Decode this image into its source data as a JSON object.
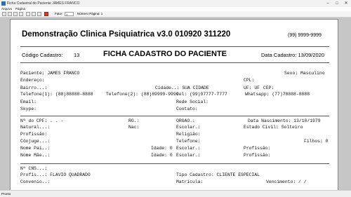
{
  "window": {
    "title": "Ficha Cadastral do Paciente JAMES FRANCO",
    "minimize": "–",
    "maximize": "□",
    "close": "✕"
  },
  "menu": {
    "items": [
      "Arquivo",
      "Página"
    ]
  },
  "toolbar": {
    "zoom_label": "Fator:",
    "zoom_value": "1",
    "page_label": "Número Página: 1"
  },
  "status": {
    "text": "Pronto"
  },
  "report": {
    "clinic_name": "Demonstração Clinica Psiquiatrica v3.0 010920 311220",
    "clinic_phone": "(99) 9999-9999",
    "code_label": "Código Cadastro:",
    "code_value": "13",
    "form_title": "FICHA CADASTRO DO PACIENTE",
    "register_date": "Data Cadastro: 13/09/2020",
    "fields": [
      {
        "text": "Paciente: JAMES FRANCO",
        "col": 0,
        "row": 0
      },
      {
        "text": "Sexo: Masculino",
        "col": 5,
        "row": 0
      },
      {
        "text": "Endereço:",
        "col": 0,
        "row": 1
      },
      {
        "text": "CPL:",
        "col": 6,
        "row": 1
      },
      {
        "text": "Bairro...:",
        "col": 0,
        "row": 2
      },
      {
        "text": "Cidade..: SUA CIDADE",
        "col": 2,
        "row": 2
      },
      {
        "text": "UF: UF",
        "col": 6,
        "row": 2
      },
      {
        "text": "CEP:",
        "col": 7,
        "row": 2
      },
      {
        "text": "Telefone(1): (88)88888-8888",
        "col": 0,
        "row": 3
      },
      {
        "text": "Telefone(2): (88)89999-9999",
        "col": 1,
        "row": 3
      },
      {
        "text": "Cel: (99)97777-7777",
        "col": 3,
        "row": 3
      },
      {
        "text": "Whatsapp: (77)78888-8888",
        "col": 4,
        "row": 3
      },
      {
        "text": "Email:",
        "col": 0,
        "row": 4
      },
      {
        "text": "Rede Social:",
        "col": 3,
        "row": 4
      },
      {
        "text": "Skype:",
        "col": 0,
        "row": 5
      },
      {
        "text": "Contato:",
        "col": 3,
        "row": 5
      },
      {
        "text": "Nº do CPF:   .   .   -",
        "col": 0,
        "row": 6
      },
      {
        "text": "RG.:",
        "col": 8,
        "row": 6
      },
      {
        "text": "ORGAO.:",
        "col": 3,
        "row": 6
      },
      {
        "text": "Data Nascimento: 13/10/1979",
        "col": 9,
        "row": 6
      },
      {
        "text": "Natural...:",
        "col": 0,
        "row": 7
      },
      {
        "text": "Nac:",
        "col": 8,
        "row": 7
      },
      {
        "text": "Escolar.:",
        "col": 3,
        "row": 7
      },
      {
        "text": "Estado Civil: Solteiro",
        "col": 10,
        "row": 7
      },
      {
        "text": "Profissão:",
        "col": 0,
        "row": 8
      },
      {
        "text": "Religião:",
        "col": 3,
        "row": 8
      },
      {
        "text": "Cônjuge...:",
        "col": 0,
        "row": 9
      },
      {
        "text": "Telefone:",
        "col": 3,
        "row": 9
      },
      {
        "text": "Filhos:  0",
        "col": 11,
        "row": 9
      },
      {
        "text": "Nome Pai..:",
        "col": 0,
        "row": 10
      },
      {
        "text": "Idade:  0",
        "col": 12,
        "row": 10
      },
      {
        "text": "Escolar.:",
        "col": 3,
        "row": 10
      },
      {
        "text": "Profissão:",
        "col": 10,
        "row": 10
      },
      {
        "text": "Nome Mãe..:",
        "col": 0,
        "row": 11
      },
      {
        "text": "Idade:  0",
        "col": 12,
        "row": 11
      },
      {
        "text": "Escolar.:",
        "col": 3,
        "row": 11
      },
      {
        "text": "Profissão:",
        "col": 10,
        "row": 11
      },
      {
        "text": "Nº CNS...:",
        "col": 0,
        "row": 12
      },
      {
        "text": "Profis...: FLAVIO QUADRADO",
        "col": 0,
        "row": 13
      },
      {
        "text": "Tipo Cadastro: CLIENTE ESPECIAL",
        "col": 3,
        "row": 13
      },
      {
        "text": "Convenio..:",
        "col": 0,
        "row": 14
      },
      {
        "text": "Matricula:",
        "col": 3,
        "row": 14
      },
      {
        "text": "Vencimento:  /  /",
        "col": 13,
        "row": 14
      }
    ]
  }
}
